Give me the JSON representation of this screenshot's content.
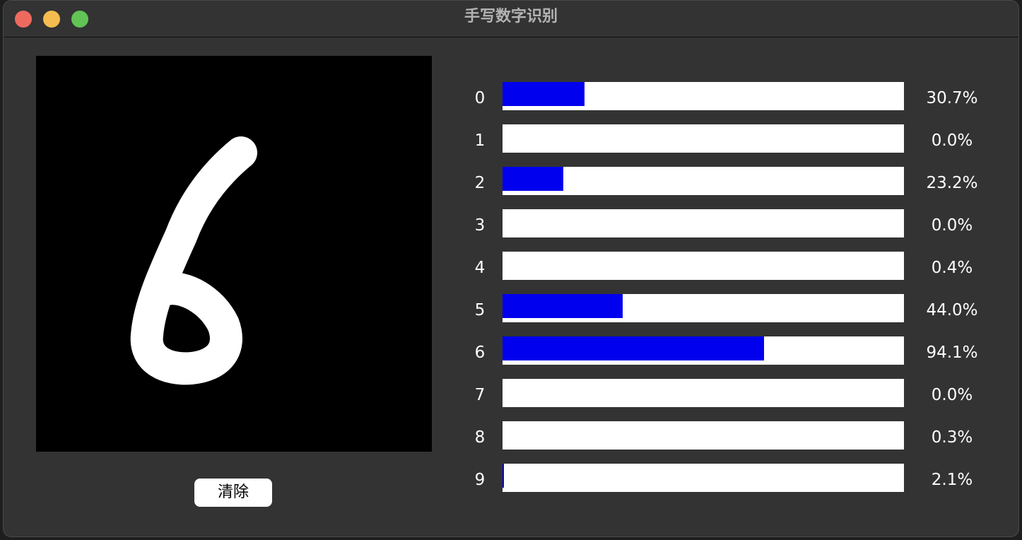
{
  "window": {
    "title": "手写数字识别"
  },
  "canvas": {
    "drawn_digit": "6"
  },
  "controls": {
    "clear_label": "清除"
  },
  "colors": {
    "bar_fill": "#0000ee",
    "bar_track": "#ffffff",
    "canvas_bg": "#000000",
    "stroke": "#ffffff"
  },
  "predictions": [
    {
      "digit": "0",
      "percent": "30.7%",
      "bar_fraction": 0.204
    },
    {
      "digit": "1",
      "percent": "0.0%",
      "bar_fraction": 0.0
    },
    {
      "digit": "2",
      "percent": "23.2%",
      "bar_fraction": 0.151
    },
    {
      "digit": "3",
      "percent": "0.0%",
      "bar_fraction": 0.0
    },
    {
      "digit": "4",
      "percent": "0.4%",
      "bar_fraction": 0.0
    },
    {
      "digit": "5",
      "percent": "44.0%",
      "bar_fraction": 0.299
    },
    {
      "digit": "6",
      "percent": "94.1%",
      "bar_fraction": 0.651
    },
    {
      "digit": "7",
      "percent": "0.0%",
      "bar_fraction": 0.0
    },
    {
      "digit": "8",
      "percent": "0.3%",
      "bar_fraction": 0.0
    },
    {
      "digit": "9",
      "percent": "2.1%",
      "bar_fraction": 0.004
    }
  ]
}
